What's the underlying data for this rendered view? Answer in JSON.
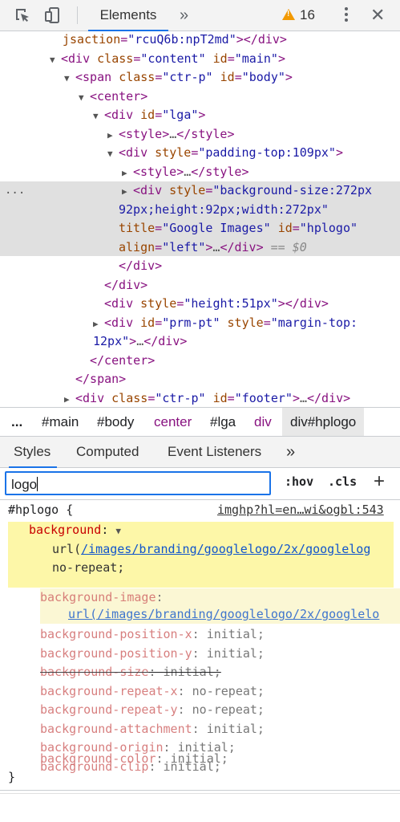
{
  "toolbar": {
    "tab_elements": "Elements",
    "more_tabs": "»",
    "warnings_count": "16",
    "close": "✕"
  },
  "tree": {
    "r1": {
      "attr": "jsaction",
      "val": "\"rcuQ6b:npT2md\"",
      "close": "></div>"
    },
    "r2": {
      "tag": "div",
      "a1": "class",
      "v1": "\"content\"",
      "a2": "id",
      "v2": "\"main\""
    },
    "r3": {
      "tag": "span",
      "a1": "class",
      "v1": "\"ctr-p\"",
      "a2": "id",
      "v2": "\"body\""
    },
    "r4": {
      "tag": "center"
    },
    "r5": {
      "tag": "div",
      "a1": "id",
      "v1": "\"lga\""
    },
    "r6": {
      "tag": "style",
      "ellipsis": "…",
      "close": "</style>"
    },
    "r7": {
      "tag": "div",
      "a1": "style",
      "v1": "\"padding-top:109px\""
    },
    "r8": {
      "tag": "style",
      "ellipsis": "…",
      "close": "</style>"
    },
    "r9a": {
      "tag": "div",
      "a1": "style",
      "v1": "\"background-size:272px"
    },
    "r9b": {
      "v": "92px;height:92px;width:272px\""
    },
    "r9c": {
      "a1": "title",
      "v1": "\"Google Images\"",
      "a2": "id",
      "v2": "\"hplogo\""
    },
    "r9d": {
      "a1": "align",
      "v1": "\"left\"",
      "ellipsis": "…",
      "close": "</div>",
      "eq": "== $0"
    },
    "r10": {
      "close": "</div>"
    },
    "r11": {
      "close": "</div>"
    },
    "r12": {
      "tag": "div",
      "a1": "style",
      "v1": "\"height:51px\"",
      "close": "></div>"
    },
    "r13a": {
      "tag": "div",
      "a1": "id",
      "v1": "\"prm-pt\"",
      "a2": "style",
      "v2": "\"margin-top:"
    },
    "r13b": {
      "v": "12px\"",
      "ellipsis": "…",
      "close": "</div>"
    },
    "r14": {
      "close": "</center>"
    },
    "r15": {
      "close": "</span>"
    },
    "r16": {
      "tag": "div",
      "a1": "class",
      "v1": "\"ctr-p\"",
      "a2": "id",
      "v2": "\"footer\"",
      "ellipsis": "…",
      "close": "</div>"
    },
    "more": "..."
  },
  "breadcrumbs": [
    "...",
    "#main",
    "#body",
    "center",
    "#lga",
    "div",
    "div#hplogo"
  ],
  "lower_tabs": [
    "Styles",
    "Computed",
    "Event Listeners",
    "»"
  ],
  "filter": {
    "value": "logo"
  },
  "filter_buttons": {
    "hov": ":hov",
    "cls": ".cls",
    "add": "+"
  },
  "rule": {
    "selector": "#hplogo",
    "open": " {",
    "source": "imghp?hl=en…wi&ogbl:543",
    "main_prop": "background",
    "main_url": "/images/branding/googlelogo/2x/googlelog",
    "main_url_prefix": "url(",
    "main_end": "no-repeat;",
    "sub": [
      {
        "name": "background-image",
        "value": "url(/images/branding/googlelogo/2x/googlelo"
      },
      {
        "name": "background-position-x",
        "value": "initial;"
      },
      {
        "name": "background-position-y",
        "value": "initial;"
      },
      {
        "name": "background-size",
        "value": "initial;",
        "struck": true
      },
      {
        "name": "background-repeat-x",
        "value": "no-repeat;"
      },
      {
        "name": "background-repeat-y",
        "value": "no-repeat;"
      },
      {
        "name": "background-attachment",
        "value": "initial;"
      },
      {
        "name": "background-origin",
        "value": "initial;"
      },
      {
        "name": "background-clip",
        "value": "initial;"
      },
      {
        "name": "background-color",
        "value": "initial;"
      }
    ],
    "close": "}"
  }
}
